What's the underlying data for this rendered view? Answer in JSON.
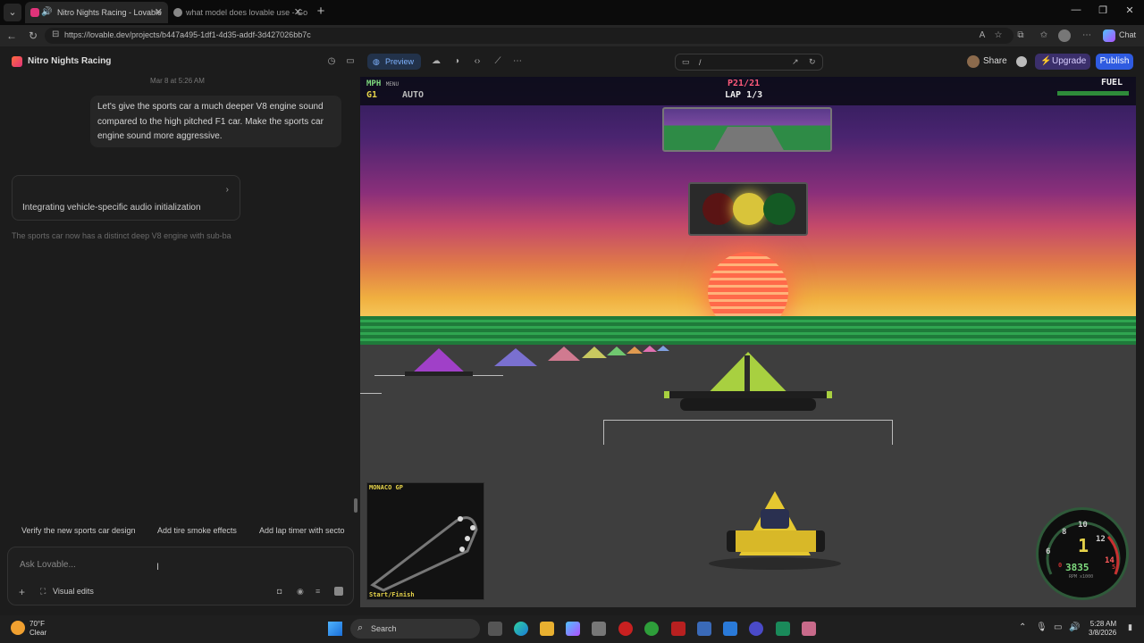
{
  "browser": {
    "tabs": [
      {
        "title": "Nitro Nights Racing - Lovable",
        "active": true,
        "favicon_color": "#e0337a"
      },
      {
        "title": "what model does lovable use - Go",
        "active": false,
        "favicon_color": "#888888"
      }
    ],
    "url": "https://lovable.dev/projects/b447a495-1df1-4d35-addf-3d427026bb7c",
    "copilot_label": "Chat"
  },
  "app": {
    "project_name": "Nitro Nights Racing",
    "preview_label": "Preview",
    "route": "/",
    "share_label": "Share",
    "upgrade_label": "Upgrade",
    "publish_label": "Publish",
    "accent_color": "#2f5be0"
  },
  "chat": {
    "date": "Mar 8 at 5:26 AM",
    "user_message": "Let's give the sports car a much deeper V8 engine sound compared to the high pitched F1 car. Make the sports car engine sound more aggressive.",
    "task_label": "Integrating vehicle-specific audio initialization",
    "assistant_preview": "The sports car now has a distinct deep V8 engine with sub-ba",
    "suggestions": [
      "Verify the new sports car design",
      "Add tire smoke effects",
      "Add lap timer with secto"
    ],
    "input_placeholder": "Ask Lovable...",
    "visual_edits_label": "Visual edits"
  },
  "game": {
    "hud": {
      "mph_label": "MPH",
      "menu_label": "MENU",
      "gear": "G1",
      "mode": "AUTO",
      "position": "P21/21",
      "lap": "LAP 1/3",
      "fuel_label": "FUEL",
      "fuel_level": 1.0
    },
    "minimap": {
      "track_name": "MONACO GP",
      "start_label": "Start/Finish"
    },
    "speedometer": {
      "gear": "1",
      "rpm": "3835",
      "rpm_unit": "RPM x1000",
      "ticks": [
        "6",
        "8",
        "10",
        "12",
        "14"
      ],
      "extra_digits": [
        "0",
        "5"
      ]
    }
  },
  "taskbar": {
    "temperature": "70°F",
    "condition": "Clear",
    "search_label": "Search",
    "time": "5:28 AM",
    "date": "3/8/2026"
  }
}
